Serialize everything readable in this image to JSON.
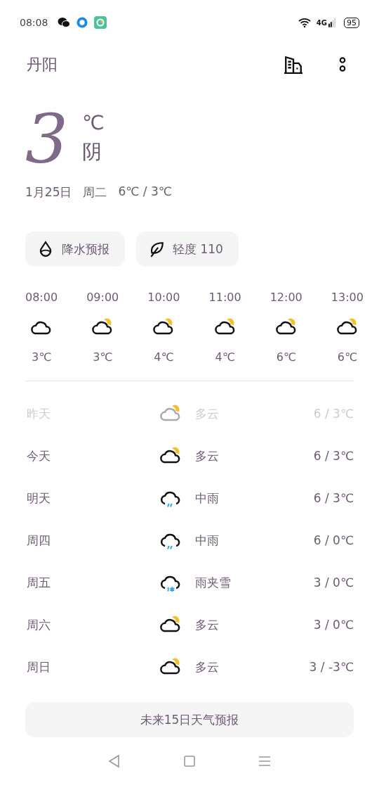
{
  "status_bar": {
    "time": "08:08",
    "network": "4G",
    "battery": "95"
  },
  "header": {
    "city": "丹阳"
  },
  "current": {
    "temperature": "3",
    "unit": "℃",
    "condition": "阴",
    "date": "1月25日",
    "weekday": "周二",
    "range": "6℃ / 3℃"
  },
  "chips": [
    {
      "kind": "rain",
      "label": "降水预报"
    },
    {
      "kind": "air",
      "label": "轻度 110"
    }
  ],
  "hourly": [
    {
      "time": "08:00",
      "kind": "cloudy",
      "temp": "3℃"
    },
    {
      "time": "09:00",
      "kind": "partly_cloudy",
      "temp": "3℃"
    },
    {
      "time": "10:00",
      "kind": "partly_cloudy",
      "temp": "4℃"
    },
    {
      "time": "11:00",
      "kind": "partly_cloudy",
      "temp": "4℃"
    },
    {
      "time": "12:00",
      "kind": "partly_cloudy",
      "temp": "6℃"
    },
    {
      "time": "13:00",
      "kind": "partly_cloudy",
      "temp": "6℃"
    }
  ],
  "daily": [
    {
      "day": "昨天",
      "kind": "partly_cloudy",
      "condition": "多云",
      "range": "6 / 3℃",
      "past": true
    },
    {
      "day": "今天",
      "kind": "partly_cloudy",
      "condition": "多云",
      "range": "6 / 3℃",
      "past": false
    },
    {
      "day": "明天",
      "kind": "rain",
      "condition": "中雨",
      "range": "6 / 3℃",
      "past": false
    },
    {
      "day": "周四",
      "kind": "rain",
      "condition": "中雨",
      "range": "6 / 0℃",
      "past": false
    },
    {
      "day": "周五",
      "kind": "sleet",
      "condition": "雨夹雪",
      "range": "3 / 0℃",
      "past": false
    },
    {
      "day": "周六",
      "kind": "partly_cloudy",
      "condition": "多云",
      "range": "3 / 0℃",
      "past": false
    },
    {
      "day": "周日",
      "kind": "partly_cloudy",
      "condition": "多云",
      "range": "3 / -3℃",
      "past": false
    }
  ],
  "forecast_button": "未来15日天气预报"
}
